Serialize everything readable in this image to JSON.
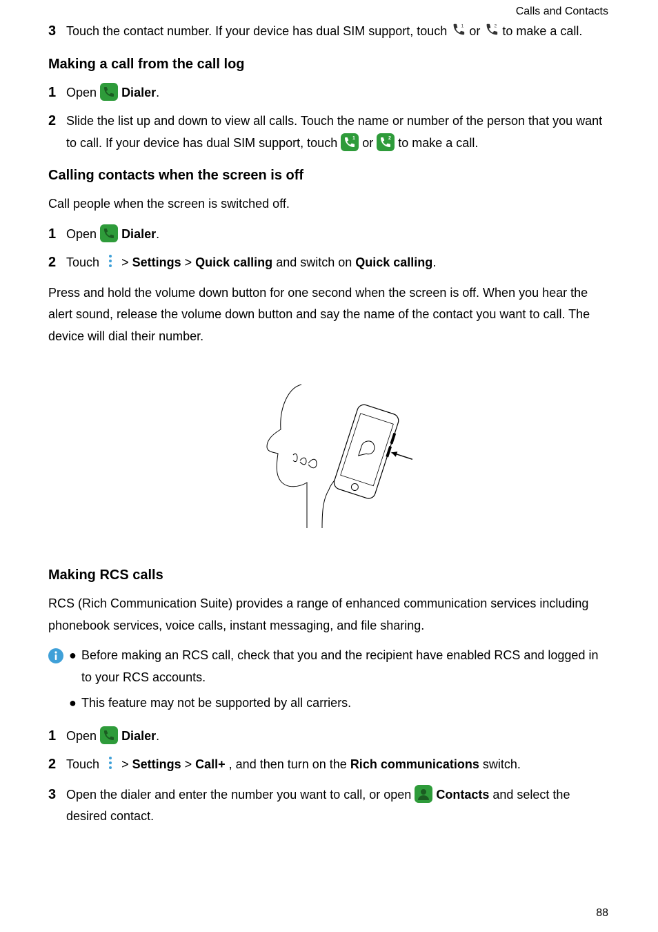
{
  "header": {
    "crumb": "Calls and Contacts"
  },
  "step3": {
    "num": "3",
    "pre": "Touch the contact number. If your device has dual SIM support, touch ",
    "mid": " or ",
    "post": " to make a call."
  },
  "sectionA": {
    "title": "Making a call from the call log",
    "s1": {
      "num": "1",
      "open": "Open ",
      "app": "Dialer",
      "after": "."
    },
    "s2": {
      "num": "2",
      "l1a": "Slide the list up and down to view all calls. Touch the name or number of the person that you want to call. If your device has dual SIM support, touch ",
      "mid": " or ",
      "l1b": " to make a call."
    }
  },
  "sectionB": {
    "title": "Calling contacts when the screen is off",
    "intro": "Call people when the screen is switched off.",
    "s1": {
      "num": "1",
      "open": "Open ",
      "app": "Dialer",
      "after": "."
    },
    "s2": {
      "num": "2",
      "a": "Touch ",
      "b": " > ",
      "settings": "Settings",
      "c": " > ",
      "qc": "Quick calling",
      "d": " and switch on ",
      "qc2": "Quick calling",
      "e": "."
    },
    "para": "Press and hold the volume down button for one second when the screen is off. When you hear the alert sound, release the volume down button and say the name of the contact you want to call. The device will dial their number."
  },
  "sectionC": {
    "title": "Making RCS calls",
    "intro": "RCS (Rich Communication Suite) provides a range of enhanced communication services including phonebook services, voice calls, instant messaging, and file sharing.",
    "bullets": [
      "Before making an RCS call, check that you and the recipient have enabled RCS and logged in to your RCS accounts.",
      "This feature may not be supported by all carriers."
    ],
    "s1": {
      "num": "1",
      "open": "Open ",
      "app": "Dialer",
      "after": "."
    },
    "s2": {
      "num": "2",
      "a": "Touch ",
      "b": " > ",
      "settings": "Settings",
      "c": " > ",
      "callplus": "Call+",
      "d": ", and then turn on the ",
      "rich": "Rich communications",
      "e": " switch."
    },
    "s3": {
      "num": "3",
      "a": "Open the dialer and enter the number you want to call, or open ",
      "contacts": "Contacts",
      "b": " and select the desired contact."
    }
  },
  "page": "88"
}
